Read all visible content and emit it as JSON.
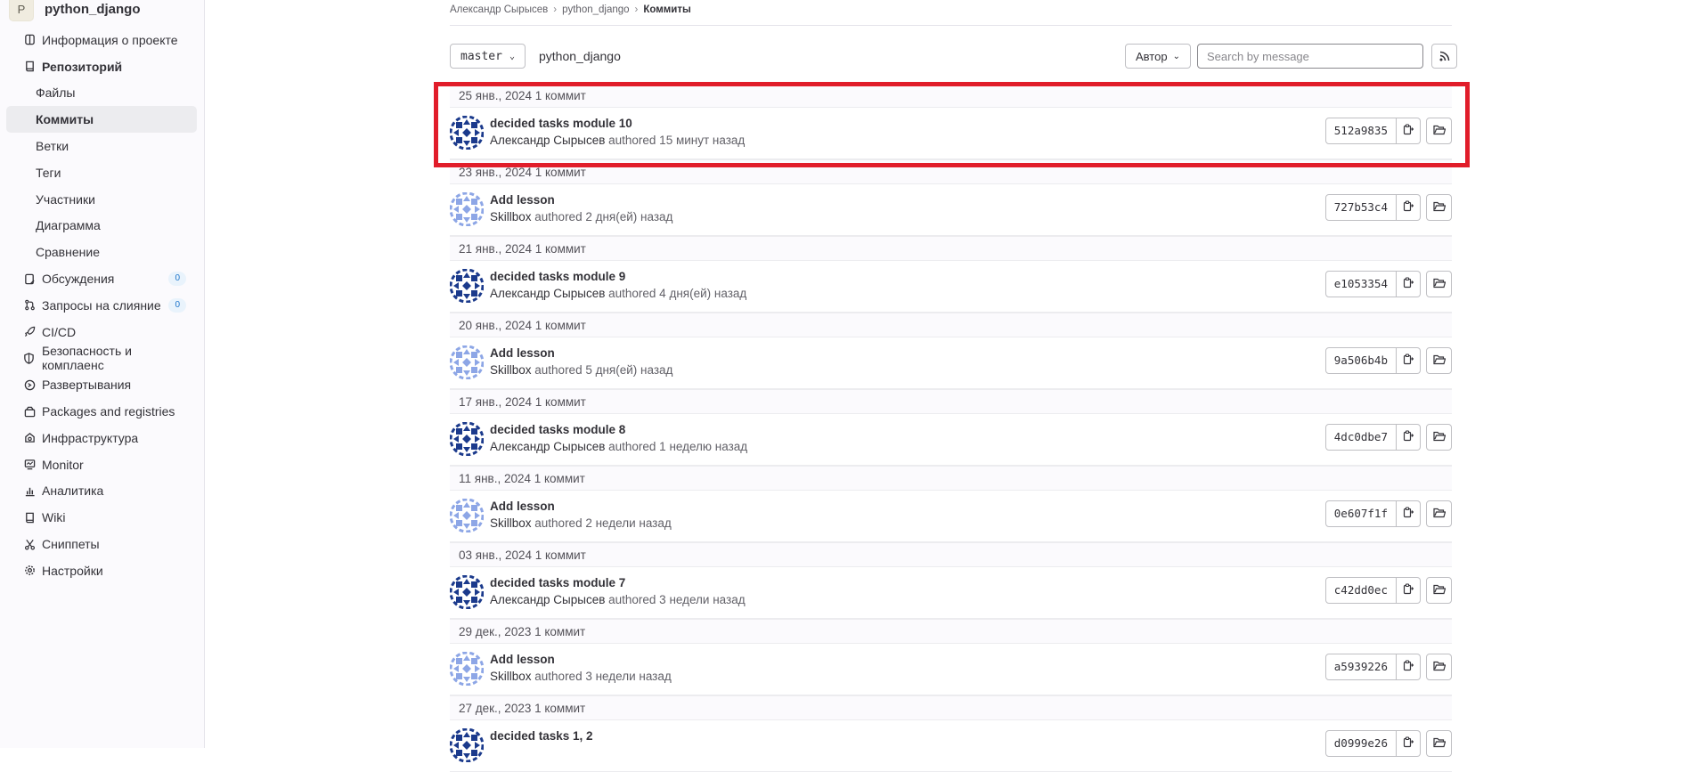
{
  "project": {
    "avatar_letter": "P",
    "name": "python_django"
  },
  "sidebar": {
    "items": [
      {
        "label": "Информация о проекте",
        "icon": "project-icon",
        "kind": "top"
      },
      {
        "label": "Репозиторий",
        "icon": "repository-icon",
        "kind": "top-bold"
      },
      {
        "label": "Файлы",
        "kind": "sub"
      },
      {
        "label": "Коммиты",
        "kind": "sub-active"
      },
      {
        "label": "Ветки",
        "kind": "sub"
      },
      {
        "label": "Теги",
        "kind": "sub"
      },
      {
        "label": "Участники",
        "kind": "sub"
      },
      {
        "label": "Диаграмма",
        "kind": "sub"
      },
      {
        "label": "Сравнение",
        "kind": "sub"
      },
      {
        "label": "Обсуждения",
        "icon": "issues-icon",
        "kind": "top",
        "badge": "0"
      },
      {
        "label": "Запросы на слияние",
        "icon": "merge-request-icon",
        "kind": "top",
        "badge": "0"
      },
      {
        "label": "CI/CD",
        "icon": "rocket-icon",
        "kind": "top"
      },
      {
        "label": "Безопасность и комплаенс",
        "icon": "shield-icon",
        "kind": "top"
      },
      {
        "label": "Развертывания",
        "icon": "deployments-icon",
        "kind": "top"
      },
      {
        "label": "Packages and registries",
        "icon": "package-icon",
        "kind": "top"
      },
      {
        "label": "Инфраструктура",
        "icon": "cloud-icon",
        "kind": "top"
      },
      {
        "label": "Monitor",
        "icon": "monitor-icon",
        "kind": "top"
      },
      {
        "label": "Аналитика",
        "icon": "chart-icon",
        "kind": "top"
      },
      {
        "label": "Wiki",
        "icon": "book-icon",
        "kind": "top"
      },
      {
        "label": "Сниппеты",
        "icon": "scissors-icon",
        "kind": "top"
      },
      {
        "label": "Настройки",
        "icon": "settings-icon",
        "kind": "top"
      }
    ]
  },
  "breadcrumb": {
    "user": "Александр Сырысев",
    "project": "python_django",
    "current": "Коммиты"
  },
  "toolbar": {
    "branch": "master",
    "path": "python_django",
    "author_label": "Автор",
    "search_placeholder": "Search by message"
  },
  "commit_groups": [
    {
      "date": "25 янв., 2024 1 коммит",
      "title": "decided tasks module 10",
      "author": "Александр Сырысев",
      "meta": " authored 15 минут назад",
      "sha": "512a9835",
      "avatar": "dark"
    },
    {
      "date": "23 янв., 2024 1 коммит",
      "title": "Add lesson",
      "author": "Skillbox",
      "meta": " authored 2 дня(ей) назад",
      "sha": "727b53c4",
      "avatar": "light"
    },
    {
      "date": "21 янв., 2024 1 коммит",
      "title": "decided tasks module 9",
      "author": "Александр Сырысев",
      "meta": " authored 4 дня(ей) назад",
      "sha": "e1053354",
      "avatar": "dark"
    },
    {
      "date": "20 янв., 2024 1 коммит",
      "title": "Add lesson",
      "author": "Skillbox",
      "meta": " authored 5 дня(ей) назад",
      "sha": "9a506b4b",
      "avatar": "light"
    },
    {
      "date": "17 янв., 2024 1 коммит",
      "title": "decided tasks module 8",
      "author": "Александр Сырысев",
      "meta": " authored 1 неделю назад",
      "sha": "4dc0dbe7",
      "avatar": "dark"
    },
    {
      "date": "11 янв., 2024 1 коммит",
      "title": "Add lesson",
      "author": "Skillbox",
      "meta": " authored 2 недели назад",
      "sha": "0e607f1f",
      "avatar": "light"
    },
    {
      "date": "03 янв., 2024 1 коммит",
      "title": "decided tasks module 7",
      "author": "Александр Сырысев",
      "meta": " authored 3 недели назад",
      "sha": "c42dd0ec",
      "avatar": "dark"
    },
    {
      "date": "29 дек., 2023 1 коммит",
      "title": "Add lesson",
      "author": "Skillbox",
      "meta": " authored 3 недели назад",
      "sha": "a5939226",
      "avatar": "light"
    },
    {
      "date": "27 дек., 2023 1 коммит",
      "title": "decided tasks 1, 2",
      "author": "",
      "meta": "",
      "sha": "d0999e26",
      "avatar": "dark"
    }
  ],
  "colors": {
    "highlight": "#e11d2a",
    "avatar_dark": "#1b3a8c",
    "avatar_light": "#8da6e6"
  }
}
